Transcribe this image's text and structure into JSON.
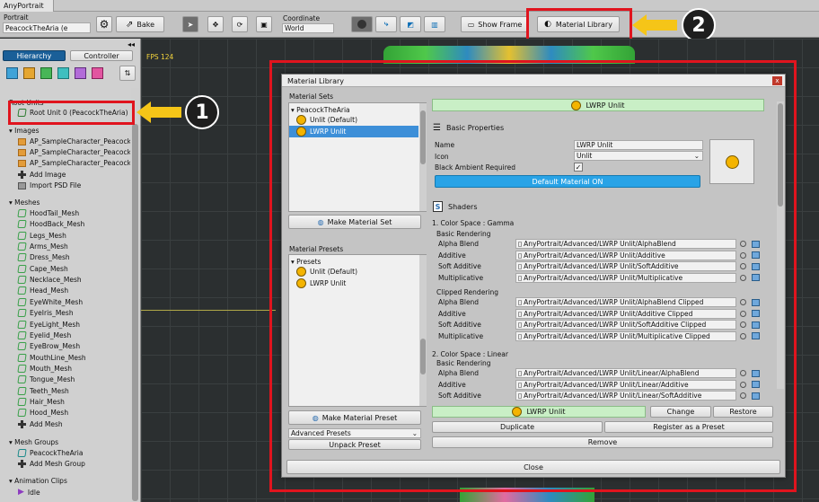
{
  "window": {
    "title": "AnyPortrait"
  },
  "toolbar": {
    "portrait_label": "Portrait",
    "portrait_value": "PeacockTheAria (e",
    "bake_label": "Bake",
    "coordinate_label": "Coordinate",
    "coordinate_value": "World",
    "show_frame_label": "Show Frame",
    "material_library_label": "Material Library"
  },
  "sidebar": {
    "tabs": [
      "Hierarchy",
      "Controller"
    ],
    "root_header": "Root Units",
    "root_unit": "Root Unit 0 (PeacockTheAria)",
    "images_header": "Images",
    "images": [
      "AP_SampleCharacter_PeacockT",
      "AP_SampleCharacter_PeacockT",
      "AP_SampleCharacter_PeacockT"
    ],
    "add_image": "Add Image",
    "import_psd": "Import PSD File",
    "meshes_header": "Meshes",
    "meshes": [
      "HoodTail_Mesh",
      "HoodBack_Mesh",
      "Legs_Mesh",
      "Arms_Mesh",
      "Dress_Mesh",
      "Cape_Mesh",
      "Necklace_Mesh",
      "Head_Mesh",
      "EyeWhite_Mesh",
      "EyeIris_Mesh",
      "EyeLight_Mesh",
      "Eyelid_Mesh",
      "EyeBrow_Mesh",
      "MouthLine_Mesh",
      "Mouth_Mesh",
      "Tongue_Mesh",
      "Teeth_Mesh",
      "Hair_Mesh",
      "Hood_Mesh"
    ],
    "add_mesh": "Add Mesh",
    "mesh_groups_header": "Mesh Groups",
    "mesh_group": "PeacockTheAria",
    "add_mesh_group": "Add Mesh Group",
    "anim_header": "Animation Clips",
    "anim_clip": "Idle"
  },
  "viewport": {
    "fps": "FPS 124"
  },
  "callouts": {
    "one": "1",
    "two": "2"
  },
  "dialog": {
    "title": "Material Library",
    "close_x": "x",
    "material_sets_header": "Material Sets",
    "sets_root": "PeacockTheAria",
    "sets": [
      "Unlit (Default)",
      "LWRP Unlit"
    ],
    "make_material_set": "Make Material Set",
    "material_presets_header": "Material Presets",
    "presets_root": "Presets",
    "presets": [
      "Unlit (Default)",
      "LWRP Unlit"
    ],
    "make_material_preset": "Make Material Preset",
    "advanced_presets": "Advanced Presets",
    "unpack_preset": "Unpack Preset",
    "selected_title": "LWRP Unlit",
    "basic_properties": "Basic Properties",
    "name_label": "Name",
    "name_value": "LWRP Unlit",
    "icon_label": "Icon",
    "icon_value": "Unlit",
    "black_ambient_label": "Black Ambient Required",
    "default_material_btn": "Default Material ON",
    "shaders_label": "Shaders",
    "gamma_header": "1. Color Space : Gamma",
    "basic_rendering": "Basic Rendering",
    "clipped_rendering": "Clipped Rendering",
    "linear_header": "2. Color Space : Linear",
    "gamma_basic": [
      {
        "label": "Alpha Blend",
        "value": "AnyPortrait/Advanced/LWRP Unlit/AlphaBlend"
      },
      {
        "label": "Additive",
        "value": "AnyPortrait/Advanced/LWRP Unlit/Additive"
      },
      {
        "label": "Soft Additive",
        "value": "AnyPortrait/Advanced/LWRP Unlit/SoftAdditive"
      },
      {
        "label": "Multiplicative",
        "value": "AnyPortrait/Advanced/LWRP Unlit/Multiplicative"
      }
    ],
    "gamma_clipped": [
      {
        "label": "Alpha Blend",
        "value": "AnyPortrait/Advanced/LWRP Unlit/AlphaBlend Clipped"
      },
      {
        "label": "Additive",
        "value": "AnyPortrait/Advanced/LWRP Unlit/Additive Clipped"
      },
      {
        "label": "Soft Additive",
        "value": "AnyPortrait/Advanced/LWRP Unlit/SoftAdditive Clipped"
      },
      {
        "label": "Multiplicative",
        "value": "AnyPortrait/Advanced/LWRP Unlit/Multiplicative Clipped"
      }
    ],
    "linear_basic": [
      {
        "label": "Alpha Blend",
        "value": "AnyPortrait/Advanced/LWRP Unlit/Linear/AlphaBlend"
      },
      {
        "label": "Additive",
        "value": "AnyPortrait/Advanced/LWRP Unlit/Linear/Additive"
      },
      {
        "label": "Soft Additive",
        "value": "AnyPortrait/Advanced/LWRP Unlit/Linear/SoftAdditive"
      }
    ],
    "bottom_preset": "LWRP Unlit",
    "change": "Change",
    "restore": "Restore",
    "duplicate": "Duplicate",
    "register_preset": "Register as a Preset",
    "remove": "Remove",
    "close": "Close"
  },
  "colors": {
    "highlight_red": "#e0141e",
    "arrow_yellow": "#f5c518",
    "selected_blue": "#3d8fd8",
    "default_btn_blue": "#29a3e6",
    "title_green": "#c9efc6"
  }
}
